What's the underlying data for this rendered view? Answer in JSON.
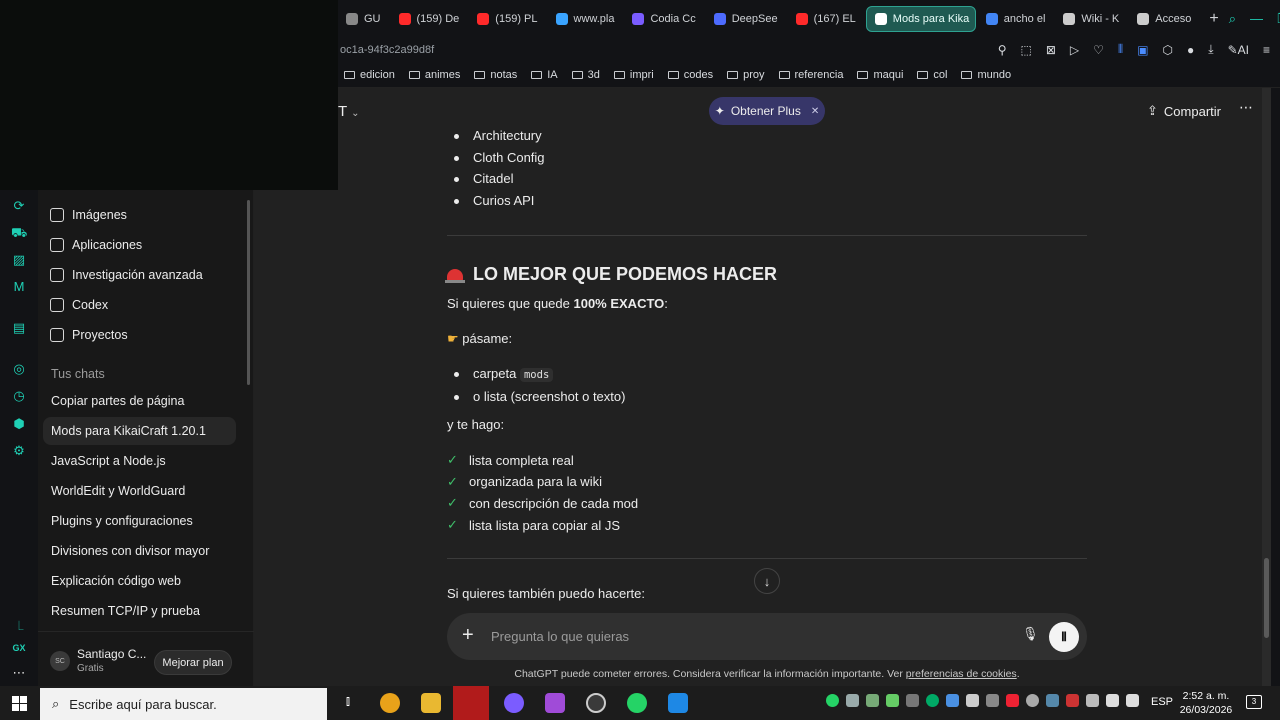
{
  "browser": {
    "tabs": [
      {
        "label": "GU",
        "color": "#888888"
      },
      {
        "label": "(159) De",
        "color": "#ff2a2a"
      },
      {
        "label": "(159) PL",
        "color": "#ff2a2a"
      },
      {
        "label": "www.pla",
        "color": "#3aa4ff"
      },
      {
        "label": "Codia Cc",
        "color": "#7a5cff"
      },
      {
        "label": "DeepSee",
        "color": "#4d6bfe"
      },
      {
        "label": "(167) EL",
        "color": "#ff2a2a"
      },
      {
        "label": "Mods para Kika",
        "color": "#ffffff",
        "active": true
      },
      {
        "label": "ancho el",
        "color": "#4285f4"
      },
      {
        "label": "Wiki - K",
        "color": "#cccccc"
      },
      {
        "label": "Acceso",
        "color": "#cccccc"
      }
    ],
    "new_tab": "+",
    "url": "oc1a-94f3c2a99d8f",
    "ai_label": "AI",
    "bookmarks": [
      {
        "label": "edicion",
        "type": "folder"
      },
      {
        "label": "animes",
        "type": "folder"
      },
      {
        "label": "notas",
        "type": "folder"
      },
      {
        "label": "IA",
        "type": "folder"
      },
      {
        "label": "3d",
        "type": "folder"
      },
      {
        "label": "impri",
        "type": "folder"
      },
      {
        "label": "codes",
        "type": "folder"
      },
      {
        "label": "proy",
        "type": "folder"
      },
      {
        "label": "referencia",
        "type": "folder"
      },
      {
        "label": "maqui",
        "type": "folder"
      },
      {
        "label": "col",
        "type": "folder"
      },
      {
        "label": "mundo",
        "type": "folder"
      }
    ]
  },
  "sidebar": {
    "nav": [
      {
        "label": "Imágenes",
        "icon": "image-icon"
      },
      {
        "label": "Aplicaciones",
        "icon": "apps-icon"
      },
      {
        "label": "Investigación avanzada",
        "icon": "telescope-icon"
      },
      {
        "label": "Codex",
        "icon": "codex-icon"
      },
      {
        "label": "Proyectos",
        "icon": "folder-icon"
      }
    ],
    "chats_label": "Tus chats",
    "chats": [
      "Copiar partes de página",
      "Mods para KikaiCraft 1.20.1",
      "JavaScript a Node.js",
      "WorldEdit y WorldGuard",
      "Plugins y configuraciones",
      "Divisiones con divisor mayor",
      "Explicación código web",
      "Resumen TCP/IP y prueba"
    ],
    "user": {
      "initials": "SC",
      "name": "Santiago C...",
      "plan": "Gratis",
      "upgrade": "Mejorar plan"
    }
  },
  "header": {
    "model": "T",
    "plus_label": "Obtener Plus",
    "share_label": "Compartir"
  },
  "message": {
    "list_top": [
      "Architectury",
      "Cloth Config",
      "Citadel",
      "Curios API"
    ],
    "heading": "LO MEJOR QUE PODEMOS HACER",
    "intro_pre": "Si quieres que quede ",
    "intro_bold": "100% EXACTO",
    "intro_post": ":",
    "pasame": "pásame:",
    "folder_pre": "carpeta ",
    "folder_code": "mods",
    "or_list": "o lista (screenshot o texto)",
    "and_do": "y te hago:",
    "checks": [
      "lista completa real",
      "organizada para la wiki",
      "con descripción de cada mod",
      "lista lista para copiar al JS"
    ],
    "also": "Si quieres también puedo hacerte:"
  },
  "composer": {
    "placeholder": "Pregunta lo que quieras",
    "disclaimer_pre": "ChatGPT puede cometer errores. Considera verificar la información importante. Ver ",
    "disclaimer_link": "preferencias de cookies",
    "disclaimer_post": "."
  },
  "taskbar": {
    "search_placeholder": "Escribe aquí para buscar.",
    "lang": "ESP",
    "time": "2:52 a. m.",
    "date": "26/03/2026"
  },
  "opera": {
    "gx_label": "GX"
  }
}
